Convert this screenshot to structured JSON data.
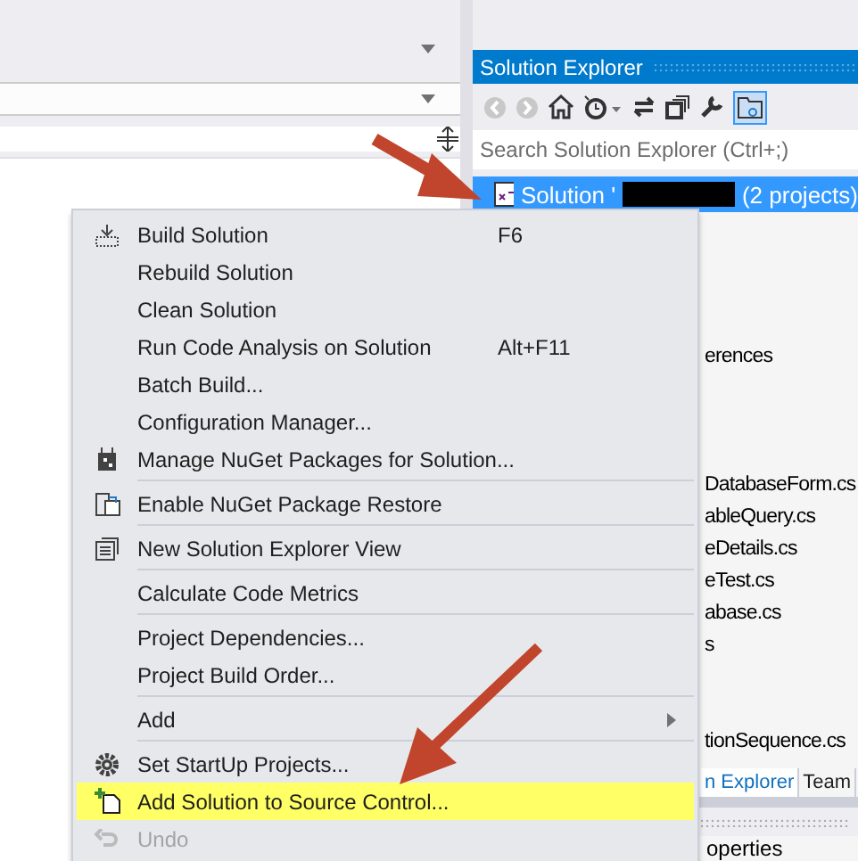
{
  "solution_explorer": {
    "title": "Solution Explorer",
    "search": {
      "placeholder": "Search Solution Explorer (Ctrl+;)"
    },
    "selected_item": {
      "prefix": "Solution '",
      "suffix": "(2 projects)",
      "selected": true
    },
    "tree_groups": [
      [
        "erences"
      ],
      [
        "DatabaseForm.cs",
        "ableQuery.cs",
        "eDetails.cs",
        "eTest.cs",
        "abase.cs",
        "s"
      ],
      [
        "tionSequence.cs"
      ]
    ],
    "tabs": [
      {
        "label": "n Explorer",
        "selected": true
      },
      {
        "label": "Team",
        "selected": false
      }
    ],
    "properties_title": "operties"
  },
  "context_menu": {
    "items": [
      {
        "kind": "item",
        "label": "Build Solution",
        "shortcut": "F6",
        "highlighted": false,
        "disabled": false
      },
      {
        "kind": "item",
        "label": "Rebuild Solution",
        "highlighted": false,
        "disabled": false
      },
      {
        "kind": "item",
        "label": "Clean Solution",
        "highlighted": false,
        "disabled": false
      },
      {
        "kind": "item",
        "label": "Run Code Analysis on Solution",
        "shortcut": "Alt+F11",
        "highlighted": false,
        "disabled": false
      },
      {
        "kind": "item",
        "label": "Batch Build...",
        "highlighted": false,
        "disabled": false
      },
      {
        "kind": "item",
        "label": "Configuration Manager...",
        "highlighted": false,
        "disabled": false
      },
      {
        "kind": "item",
        "label": "Manage NuGet Packages for Solution...",
        "highlighted": false,
        "disabled": false
      },
      {
        "kind": "separator"
      },
      {
        "kind": "item",
        "label": "Enable NuGet Package Restore",
        "highlighted": false,
        "disabled": false
      },
      {
        "kind": "separator"
      },
      {
        "kind": "item",
        "label": "New Solution Explorer View",
        "highlighted": false,
        "disabled": false
      },
      {
        "kind": "separator"
      },
      {
        "kind": "item",
        "label": "Calculate Code Metrics",
        "highlighted": false,
        "disabled": false
      },
      {
        "kind": "separator"
      },
      {
        "kind": "item",
        "label": "Project Dependencies...",
        "highlighted": false,
        "disabled": false
      },
      {
        "kind": "item",
        "label": "Project Build Order...",
        "highlighted": false,
        "disabled": false
      },
      {
        "kind": "separator"
      },
      {
        "kind": "item",
        "label": "Add",
        "submenu": true,
        "highlighted": false,
        "disabled": false
      },
      {
        "kind": "separator"
      },
      {
        "kind": "item",
        "label": "Set StartUp Projects...",
        "highlighted": false,
        "disabled": false
      },
      {
        "kind": "item",
        "label": "Add Solution to Source Control...",
        "highlighted": true,
        "disabled": false
      },
      {
        "kind": "item",
        "label": "Undo",
        "highlighted": false,
        "disabled": true
      }
    ]
  }
}
